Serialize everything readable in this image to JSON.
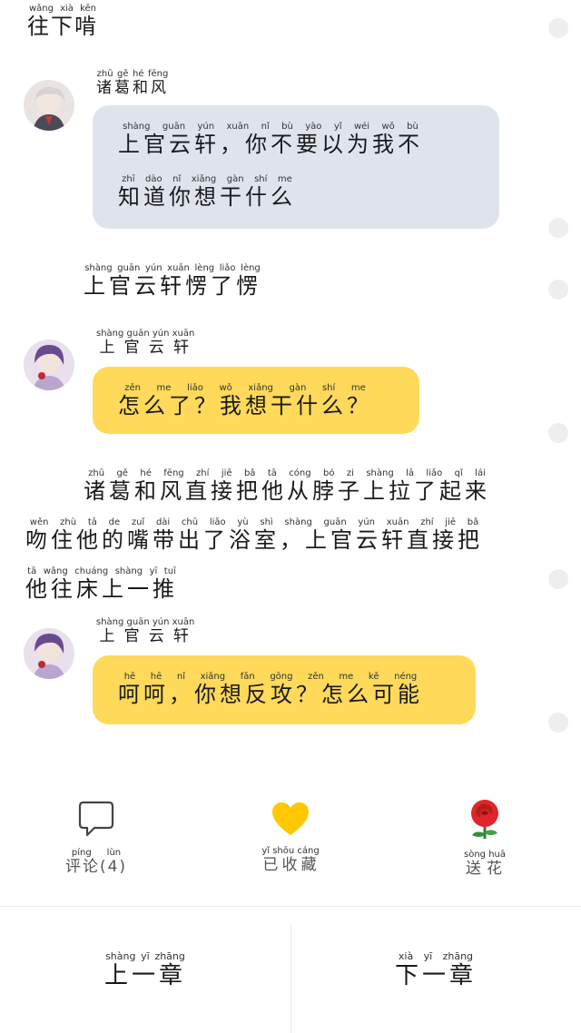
{
  "top_line": {
    "text": "往下啃",
    "pinyin": "wǎng xià kěn"
  },
  "messages": [
    {
      "speaker": "诸葛和风",
      "speaker_pinyin": "zhū gě hé fēng",
      "lines": [
        "上官云轩，你不要以为我不",
        "知道你想干什么"
      ],
      "pinyin": [
        "shàng guān yún xuān     nǐ bù yào yǐ wéi wǒ bù",
        "zhī dào nǐ xiǎng gàn shí me"
      ]
    },
    {
      "speaker": "上官云轩",
      "speaker_pinyin": "shàng guān yún xuān",
      "lines": [
        "怎么了？我想干什么？"
      ],
      "pinyin": [
        "zěn me liǎo     wǒ xiǎng gàn shí me"
      ]
    },
    {
      "speaker": "上官云轩",
      "speaker_pinyin": "shàng guān yún xuān",
      "lines": [
        "呵呵，你想反攻？怎么可能"
      ],
      "pinyin": [
        "hē hē     nǐ xiǎng fǎn gōng     zěn me kě néng"
      ]
    }
  ],
  "narration_1": {
    "text": "上官云轩愣了愣",
    "pinyin": "shàng guān yún xuān lèng liǎo lèng"
  },
  "narration_2": {
    "lines": [
      "诸葛和风直接把他从脖子上拉了起来",
      "吻住他的嘴带出了浴室，上官云轩直接把",
      "他往床上一推"
    ],
    "pinyin": [
      "zhū gě hé fēng zhí jiē bǎ tā cóng bó zi shàng lā liǎo qǐ lái",
      "wěn zhù tā de zuǐ dài chū liǎo yù shì     shàng guān yún xuān zhí jiē bǎ",
      "tā wǎng chuáng shàng yī tuī"
    ]
  },
  "actions": {
    "comment": {
      "label": "评论(4)",
      "pinyin": "píng lùn"
    },
    "collect": {
      "label": "已收藏",
      "pinyin": "yǐ shōu cáng"
    },
    "flower": {
      "label": "送花",
      "pinyin": "sòng huā"
    }
  },
  "nav": {
    "prev": {
      "label": "上一章",
      "pinyin": "shàng yī zhāng"
    },
    "next": {
      "label": "下一章",
      "pinyin": "xià yī zhāng"
    }
  },
  "colors": {
    "gray_bubble": "#dfe4ec",
    "yellow_bubble": "#fed95a",
    "heart": "#ffc800",
    "rose": "#e0262b"
  },
  "icons": [
    "speech-bubble-icon",
    "heart-icon",
    "rose-icon"
  ]
}
